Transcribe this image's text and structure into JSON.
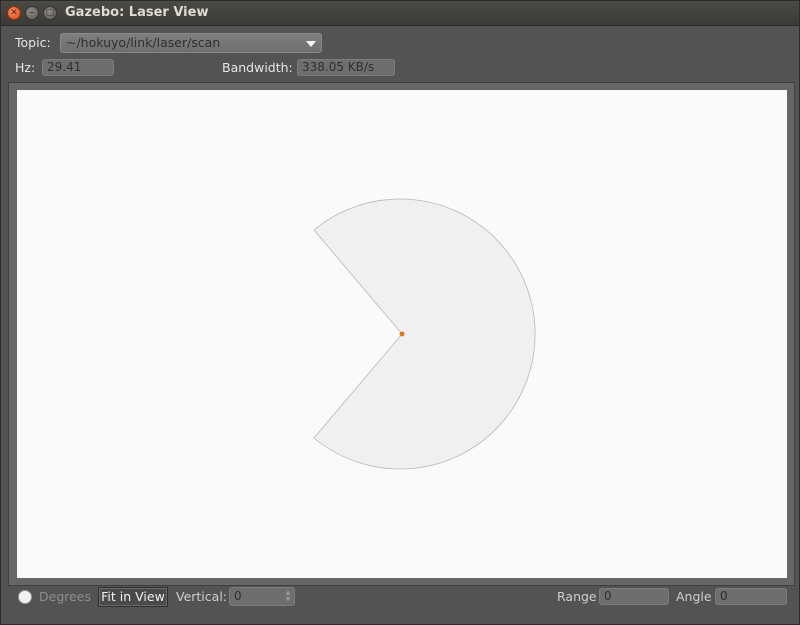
{
  "window": {
    "title": "Gazebo: Laser View"
  },
  "topic": {
    "label": "Topic:",
    "value": "~/hokuyo/link/laser/scan"
  },
  "stats": {
    "hz_label": "Hz:",
    "hz_value": "29.41",
    "bandwidth_label": "Bandwidth:",
    "bandwidth_value": "338.05 KB/s"
  },
  "bottom": {
    "degrees_label": "Degrees",
    "degrees_checked": false,
    "fit_button_label": "Fit in View",
    "vertical_label": "Vertical:",
    "vertical_value": "0",
    "range_label": "Range",
    "range_value": "0",
    "angle_label": "Angle",
    "angle_value": "0"
  },
  "icons": {
    "close": "close-icon",
    "minimize": "minimize-icon",
    "maximize": "maximize-icon",
    "dropdown": "chevron-down-icon"
  },
  "colors": {
    "scan_fill": "#f0f0f0",
    "scan_stroke": "#b8b8b8",
    "sensor_origin": "#e07a1f",
    "canvas_bg": "#fafafa"
  }
}
